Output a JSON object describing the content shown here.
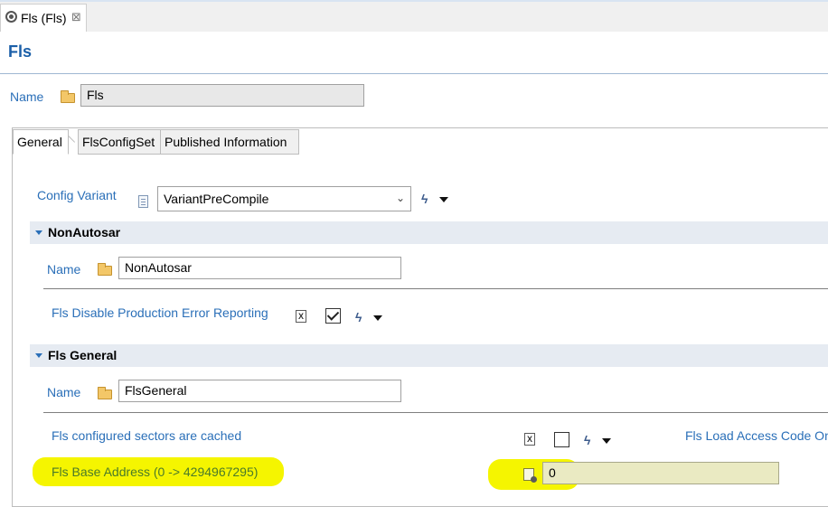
{
  "editor_tab": {
    "label": "Fls (Fls)",
    "close": "⊠"
  },
  "form": {
    "title": "Fls",
    "name_label": "Name",
    "name_value": "Fls"
  },
  "tabs": [
    {
      "label": "General",
      "active": true
    },
    {
      "label": "FlsConfigSet",
      "active": false
    },
    {
      "label": "Published Information",
      "active": false
    }
  ],
  "general": {
    "config_variant_label": "Config Variant",
    "config_variant_value": "VariantPreCompile"
  },
  "sections": {
    "non_autosar": {
      "title": "NonAutosar",
      "name_label": "Name",
      "name_value": "NonAutosar",
      "disable_prod_error_label": "Fls Disable Production Error Reporting",
      "disable_prod_error_checked": true
    },
    "fls_general": {
      "title": "Fls General",
      "name_label": "Name",
      "name_value": "FlsGeneral",
      "sectors_cached_label": "Fls configured sectors are cached",
      "sectors_cached_checked": false,
      "load_access_label": "Fls Load Access Code On",
      "base_address_label": "Fls Base Address (0 -> 4294967295)",
      "base_address_value": "0"
    }
  },
  "icons": {
    "editor": "module-icon",
    "folder": "folder-icon",
    "document": "document-icon",
    "xml": "xml-icon",
    "bolt": "bolt-icon",
    "number": "number-icon"
  },
  "colors": {
    "link": "#2a6fb8",
    "title": "#1b5fa8",
    "section_bg": "#e6ebf2",
    "highlight": "#f5f500"
  }
}
